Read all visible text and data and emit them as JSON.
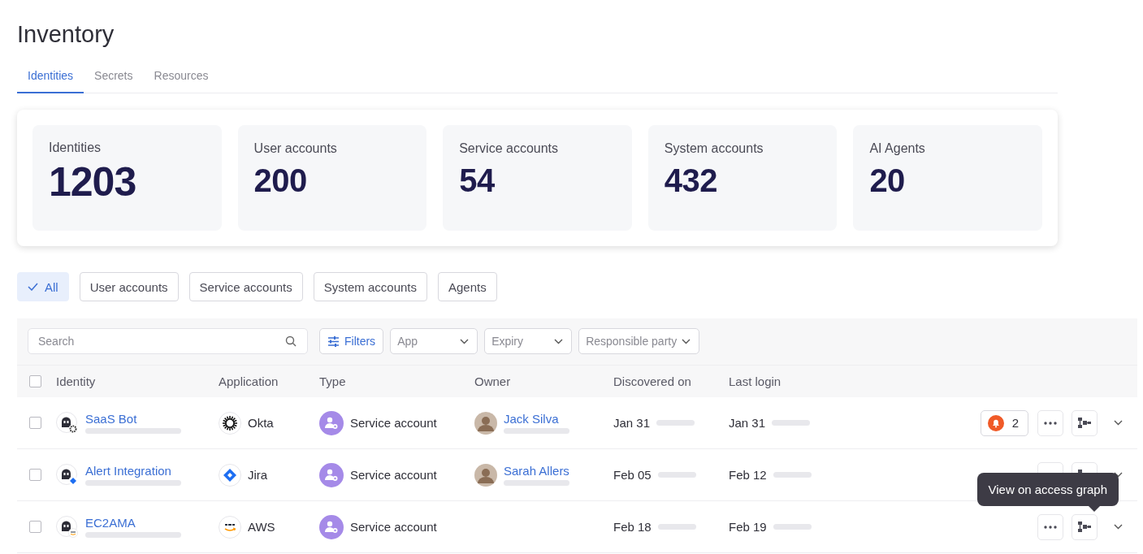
{
  "page": {
    "title": "Inventory"
  },
  "tabs": [
    {
      "label": "Identities",
      "selected": true
    },
    {
      "label": "Secrets",
      "selected": false
    },
    {
      "label": "Resources",
      "selected": false
    }
  ],
  "stats": [
    {
      "label": "Identities",
      "value": "1203",
      "primary": true
    },
    {
      "label": "User accounts",
      "value": "200",
      "primary": false
    },
    {
      "label": "Service accounts",
      "value": "54",
      "primary": false
    },
    {
      "label": "System accounts",
      "value": "432",
      "primary": false
    },
    {
      "label": "AI Agents",
      "value": "20",
      "primary": false
    }
  ],
  "chips": [
    {
      "label": "All",
      "selected": true
    },
    {
      "label": "User accounts",
      "selected": false
    },
    {
      "label": "Service accounts",
      "selected": false
    },
    {
      "label": "System accounts",
      "selected": false
    },
    {
      "label": "Agents",
      "selected": false
    }
  ],
  "toolbar": {
    "search": {
      "placeholder": "Search"
    },
    "filters_button": "Filters",
    "dropdowns": [
      "App",
      "Expiry",
      "Responsible party"
    ]
  },
  "table": {
    "select_all_checked": false,
    "columns": [
      "Identity",
      "Application",
      "Type",
      "Owner",
      "Discovered on",
      "Last login"
    ],
    "rows": [
      {
        "checked": false,
        "identity": "SaaS Bot",
        "application": "Okta",
        "kind": "okta",
        "type": "Service account",
        "owner": "Jack Silva",
        "discovered": "Jan 31",
        "last_login": "Jan 31",
        "alerts": "2"
      },
      {
        "checked": false,
        "identity": "Alert Integration",
        "application": "Jira",
        "kind": "jira",
        "type": "Service account",
        "owner": "Sarah Allers",
        "discovered": "Feb 05",
        "last_login": "Feb 12"
      },
      {
        "checked": false,
        "identity": "EC2AMA",
        "application": "AWS",
        "kind": "aws",
        "type": "Service account",
        "discovered": "Feb 18",
        "last_login": "Feb 19",
        "tooltip": "View on access graph"
      }
    ]
  }
}
